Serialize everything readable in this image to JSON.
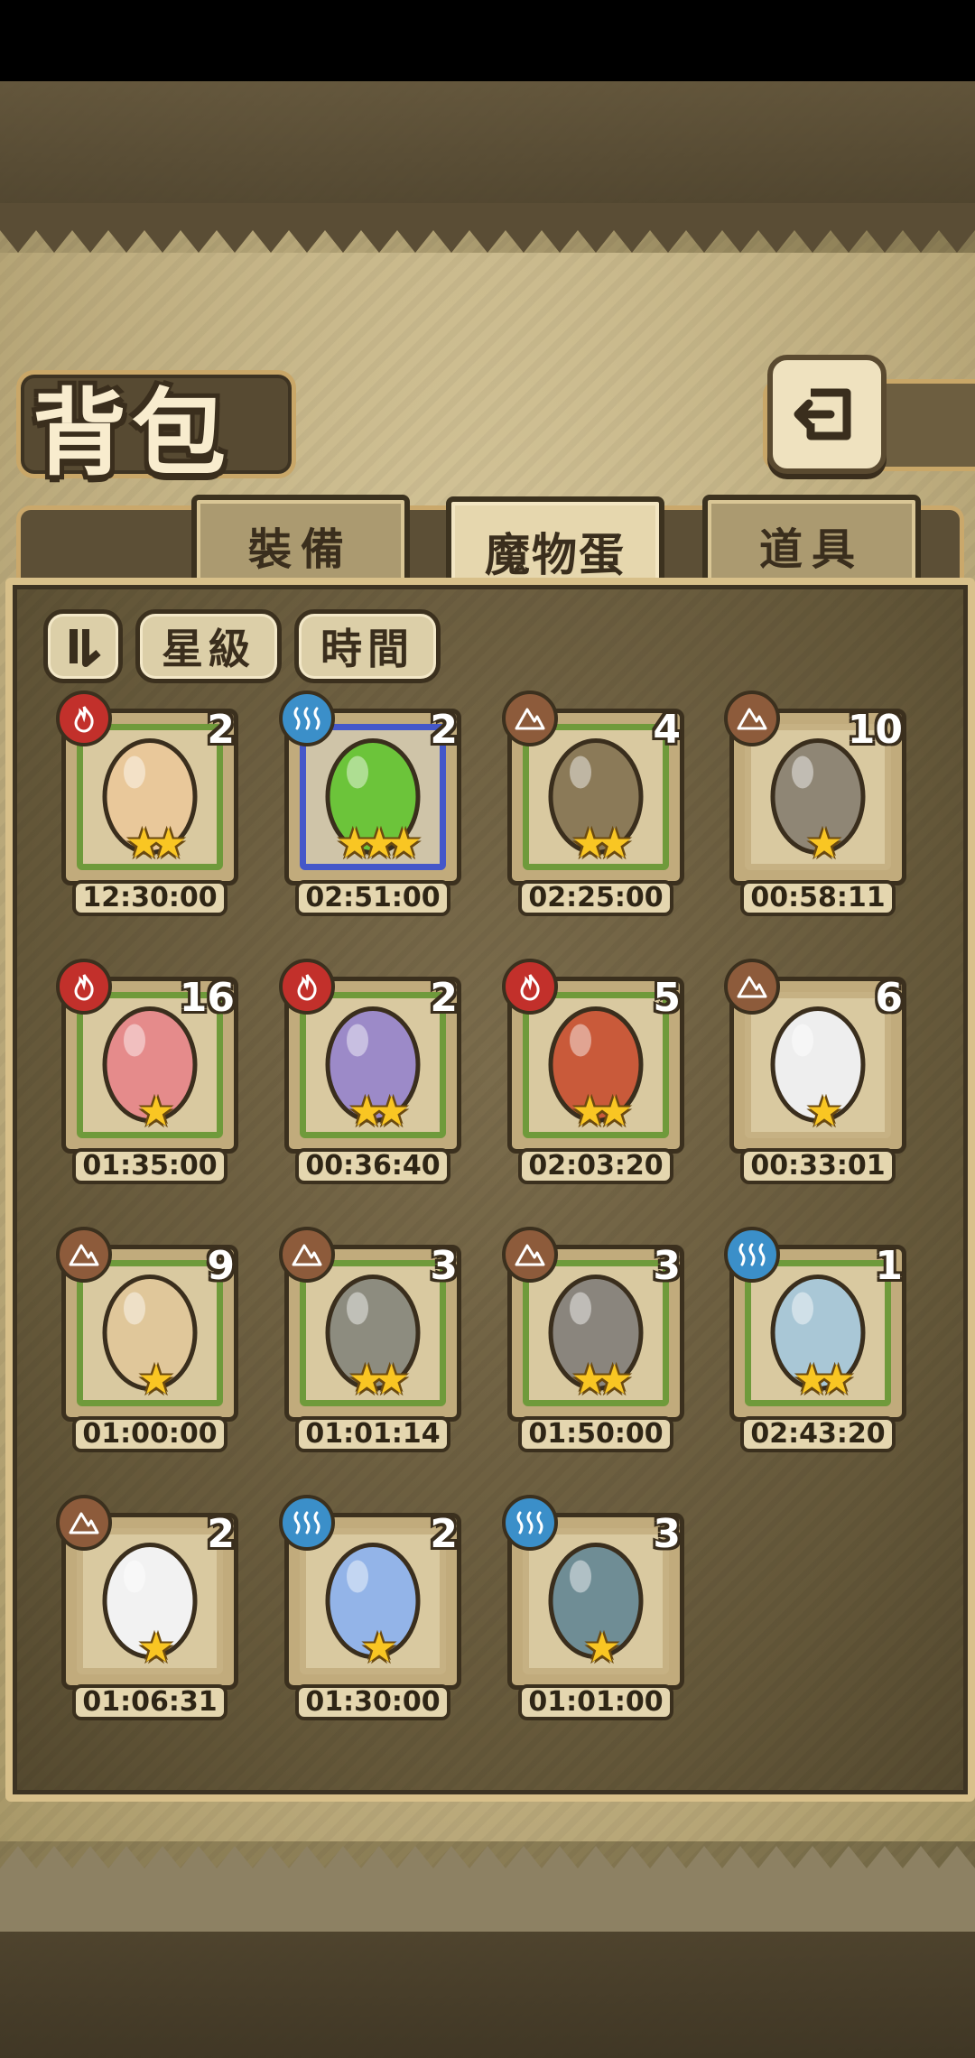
{
  "header": {
    "title": "背包",
    "back_icon": "return-arrow-icon"
  },
  "tabs": [
    {
      "label": "裝備",
      "active": false
    },
    {
      "label": "魔物蛋",
      "active": true
    },
    {
      "label": "道具",
      "active": false
    }
  ],
  "sort": {
    "toggle_icon": "sort-toggle-icon",
    "star_label": "星級",
    "time_label": "時間"
  },
  "eggs": [
    {
      "element": "fire",
      "count": "2",
      "stars": "★★",
      "time": "12:30:00",
      "color": "#e9c89a"
    },
    {
      "element": "water",
      "count": "2",
      "stars": "★★★",
      "time": "02:51:00",
      "color": "#6cc43a",
      "rare": true
    },
    {
      "element": "earth",
      "count": "4",
      "stars": "★★",
      "time": "02:25:00",
      "color": "#8b7a58"
    },
    {
      "element": "earth",
      "count": "10",
      "stars": "★",
      "time": "00:58:11",
      "color": "#8f8675",
      "plain": true
    },
    {
      "element": "fire",
      "count": "16",
      "stars": "★",
      "time": "01:35:00",
      "color": "#e58b8b"
    },
    {
      "element": "fire",
      "count": "2",
      "stars": "★★",
      "time": "00:36:40",
      "color": "#9c8ac8"
    },
    {
      "element": "fire",
      "count": "5",
      "stars": "★★",
      "time": "02:03:20",
      "color": "#c95a3a"
    },
    {
      "element": "earth",
      "count": "6",
      "stars": "★",
      "time": "00:33:01",
      "color": "#eeeeee",
      "plain": true
    },
    {
      "element": "earth",
      "count": "9",
      "stars": "★",
      "time": "01:00:00",
      "color": "#e0c79a"
    },
    {
      "element": "earth",
      "count": "3",
      "stars": "★★",
      "time": "01:01:14",
      "color": "#8d8c7f"
    },
    {
      "element": "earth",
      "count": "3",
      "stars": "★★",
      "time": "01:50:00",
      "color": "#8a857d"
    },
    {
      "element": "water",
      "count": "1",
      "stars": "★★",
      "time": "02:43:20",
      "color": "#a9c7d6"
    },
    {
      "element": "earth",
      "count": "2",
      "stars": "★",
      "time": "01:06:31",
      "color": "#f2f2f2",
      "plain": true
    },
    {
      "element": "water",
      "count": "2",
      "stars": "★",
      "time": "01:30:00",
      "color": "#93b4e8",
      "plain": true
    },
    {
      "element": "water",
      "count": "3",
      "stars": "★",
      "time": "01:01:00",
      "color": "#6f8d95",
      "plain": true
    }
  ]
}
